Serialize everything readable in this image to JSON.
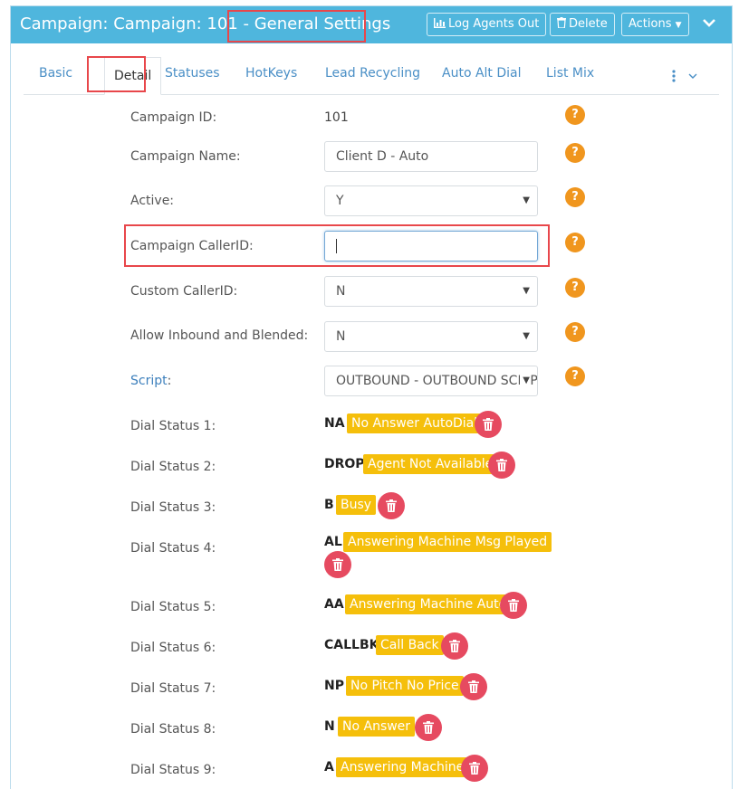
{
  "header": {
    "title_prefix": "Campaign: Campaign: 101 - ",
    "title_highlight": "General Settings",
    "log_agents_out": "Log Agents Out",
    "delete": "Delete",
    "actions": "Actions",
    "accent_color": "#4fb6dd"
  },
  "tabs": [
    {
      "label": "Basic"
    },
    {
      "label": "Detail"
    },
    {
      "label": "Statuses"
    },
    {
      "label": "HotKeys"
    },
    {
      "label": "Lead Recycling"
    },
    {
      "label": "Auto Alt Dial"
    },
    {
      "label": "List Mix"
    }
  ],
  "form": {
    "campaign_id_label": "Campaign ID:",
    "campaign_id_value": "101",
    "campaign_name_label": "Campaign Name:",
    "campaign_name_value": "Client D - Auto",
    "active_label": "Active:",
    "active_value": "Y",
    "callerid_label": "Campaign CallerID:",
    "callerid_value": "",
    "custom_callerid_label": "Custom CallerID:",
    "custom_callerid_value": "N",
    "inbound_label": "Allow Inbound and Blended:",
    "inbound_value": "N",
    "script_label": "Script",
    "script_colon": ":",
    "script_value": "OUTBOUND - OUTBOUND SCRIPT"
  },
  "dial_statuses": [
    {
      "label": "Dial Status 1:",
      "code": "NA",
      "name": "No Answer AutoDial"
    },
    {
      "label": "Dial Status 2:",
      "code": "DROP",
      "name": "Agent Not Available"
    },
    {
      "label": "Dial Status 3:",
      "code": "B",
      "name": "Busy"
    },
    {
      "label": "Dial Status 4:",
      "code": "AL",
      "name": "Answering Machine Msg Played"
    },
    {
      "label": "Dial Status 5:",
      "code": "AA",
      "name": "Answering Machine Auto"
    },
    {
      "label": "Dial Status 6:",
      "code": "CALLBK",
      "name": "Call Back"
    },
    {
      "label": "Dial Status 7:",
      "code": "NP",
      "name": "No Pitch No Price"
    },
    {
      "label": "Dial Status 8:",
      "code": "N",
      "name": "No Answer"
    },
    {
      "label": "Dial Status 9:",
      "code": "A",
      "name": "Answering Machine"
    }
  ],
  "colors": {
    "badge": "#f5bf0b",
    "delete_button": "#e64a60",
    "help_icon": "#f0961e",
    "highlight_box": "#e8474b"
  }
}
